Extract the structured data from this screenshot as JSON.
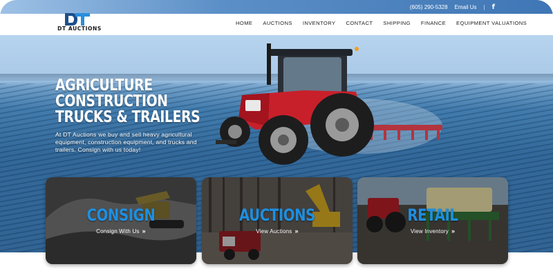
{
  "topbar": {
    "phone": "(605) 290-5328",
    "email_label": "Email Us",
    "separator": "|",
    "social_icon": "facebook-icon",
    "social_glyph": "f"
  },
  "brand": {
    "logo_mark": "DT",
    "logo_text": "DT AUCTIONS"
  },
  "nav": {
    "items": [
      "HOME",
      "AUCTIONS",
      "INVENTORY",
      "CONTACT",
      "SHIPPING",
      "FINANCE",
      "EQUIPMENT VALUATIONS"
    ]
  },
  "hero": {
    "title_lines": [
      "AGRICULTURE",
      "CONSTRUCTION",
      "TRUCKS & TRAILERS"
    ],
    "subtitle": "At DT Auctions we buy and sell heavy agricultural equipment, construction equipment, and trucks and trailers. Consign with us today!"
  },
  "cards": [
    {
      "title": "CONSIGN",
      "link": "Consign With Us",
      "chevron": "»"
    },
    {
      "title": "AUCTIONS",
      "link": "View Auctions",
      "chevron": "»"
    },
    {
      "title": "RETAIL",
      "link": "View Inventory",
      "chevron": "»"
    }
  ],
  "colors": {
    "accent": "#1e8fe0",
    "topbar": "#3f76b5",
    "tractor_red": "#c8202b"
  }
}
